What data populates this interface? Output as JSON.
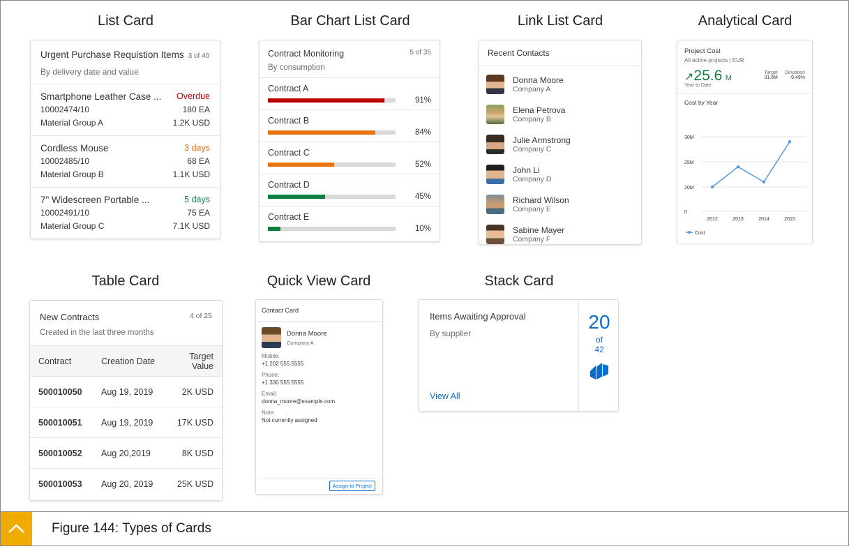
{
  "headings": {
    "list": "List Card",
    "bar": "Bar Chart List Card",
    "link": "Link List Card",
    "analytical": "Analytical Card",
    "table": "Table Card",
    "quick": "Quick View Card",
    "stack": "Stack Card"
  },
  "list_card": {
    "title": "Urgent Purchase Requistion Items",
    "count": "3 of 40",
    "subtitle": "By delivery date and value",
    "items": [
      {
        "name": "Smartphone Leather Case ...",
        "status": "Overdue",
        "status_color": "#bb0000",
        "id": "10002474/10",
        "qty": "180 EA",
        "group": "Material Group A",
        "value": "1.2K USD"
      },
      {
        "name": "Cordless Mouse",
        "status": "3 days",
        "status_color": "#e9730c",
        "id": "10002485/10",
        "qty": "68 EA",
        "group": "Material Group B",
        "value": "1.1K USD"
      },
      {
        "name": "7\" Widescreen Portable ...",
        "status": "5 days",
        "status_color": "#107e3e",
        "id": "10002491/10",
        "qty": "75 EA",
        "group": "Material Group C",
        "value": "7.1K USD"
      }
    ]
  },
  "bar_card": {
    "title": "Contract Monitoring",
    "count": "5 of 35",
    "subtitle": "By consumption",
    "items": [
      {
        "name": "Contract A",
        "pct_label": "91%",
        "value": 0.91,
        "color": "#bb0000"
      },
      {
        "name": "Contract B",
        "pct_label": "84%",
        "value": 0.84,
        "color": "#e9730c"
      },
      {
        "name": "Contract C",
        "pct_label": "52%",
        "value": 0.52,
        "color": "#e9730c"
      },
      {
        "name": "Contract D",
        "pct_label": "45%",
        "value": 0.45,
        "color": "#107e3e"
      },
      {
        "name": "Contract E",
        "pct_label": "10%",
        "value": 0.1,
        "color": "#107e3e"
      }
    ]
  },
  "link_card": {
    "title": "Recent Contacts",
    "items": [
      {
        "name": "Donna Moore",
        "company": "Company A"
      },
      {
        "name": "Elena Petrova",
        "company": "Company B"
      },
      {
        "name": "Julie Armstrong",
        "company": "Company C"
      },
      {
        "name": "John Li",
        "company": "Company D"
      },
      {
        "name": "Richard Wilson",
        "company": "Company E"
      },
      {
        "name": "Sabine Mayer",
        "company": "Company F"
      }
    ]
  },
  "analytical_card": {
    "title": "Project Cost",
    "subtitle": "All active projects | EUR",
    "kpi_arrow": "↗",
    "kpi_value": "25.6",
    "kpi_unit": "M",
    "kpi_color": "#107e3e",
    "target_label": "Target",
    "target_value": "31.6M",
    "deviation_label": "Deviation",
    "deviation_value": "-9.49%",
    "period": "Year to Date",
    "chart_title": "Cost by Year",
    "legend": "Cost",
    "y_ticks": [
      "30M",
      "25M",
      "20M",
      "0"
    ],
    "x_ticks": [
      "2012",
      "2013",
      "2014",
      "2015"
    ]
  },
  "chart_data": {
    "type": "line",
    "title": "Cost by Year",
    "x": [
      "2012",
      "2013",
      "2014",
      "2015"
    ],
    "series": [
      {
        "name": "Cost",
        "values": [
          20,
          24,
          21,
          29
        ]
      }
    ],
    "y_ticks": [
      "30M",
      "25M",
      "20M",
      "0"
    ],
    "ylim": [
      0,
      30
    ],
    "legend_position": "bottom-left",
    "color": "#5899da"
  },
  "table_card": {
    "title": "New Contracts",
    "count": "4 of 25",
    "subtitle": "Created in the last three months",
    "columns": [
      "Contract",
      "Creation Date",
      "Target Value"
    ],
    "rows": [
      [
        "500010050",
        "Aug 19, 2019",
        "2K USD"
      ],
      [
        "500010051",
        "Aug 19, 2019",
        "17K USD"
      ],
      [
        "500010052",
        "Aug 20,2019",
        "8K USD"
      ],
      [
        "500010053",
        "Aug 20, 2019",
        "25K USD"
      ]
    ]
  },
  "quick_view": {
    "title": "Contact Card",
    "name": "Donna Moore",
    "company": "Company A",
    "fields": [
      {
        "label": "Mobile:",
        "value": "+1 202 555 5555"
      },
      {
        "label": "Phone:",
        "value": "+1 330 555 5555"
      },
      {
        "label": "Email:",
        "value": "donna_moore@example.com"
      },
      {
        "label": "Note:",
        "value": "Not currently assigned"
      }
    ],
    "action": "Assign to Project"
  },
  "stack_card": {
    "title": "Items Awaiting Approval",
    "subtitle": "By supplier",
    "link": "View All",
    "count": "20",
    "of_label": "of",
    "total": "42",
    "accent": "#0a6ed1"
  },
  "footer": {
    "caption": "Figure 144: Types of Cards",
    "accent": "#f0ab00"
  }
}
